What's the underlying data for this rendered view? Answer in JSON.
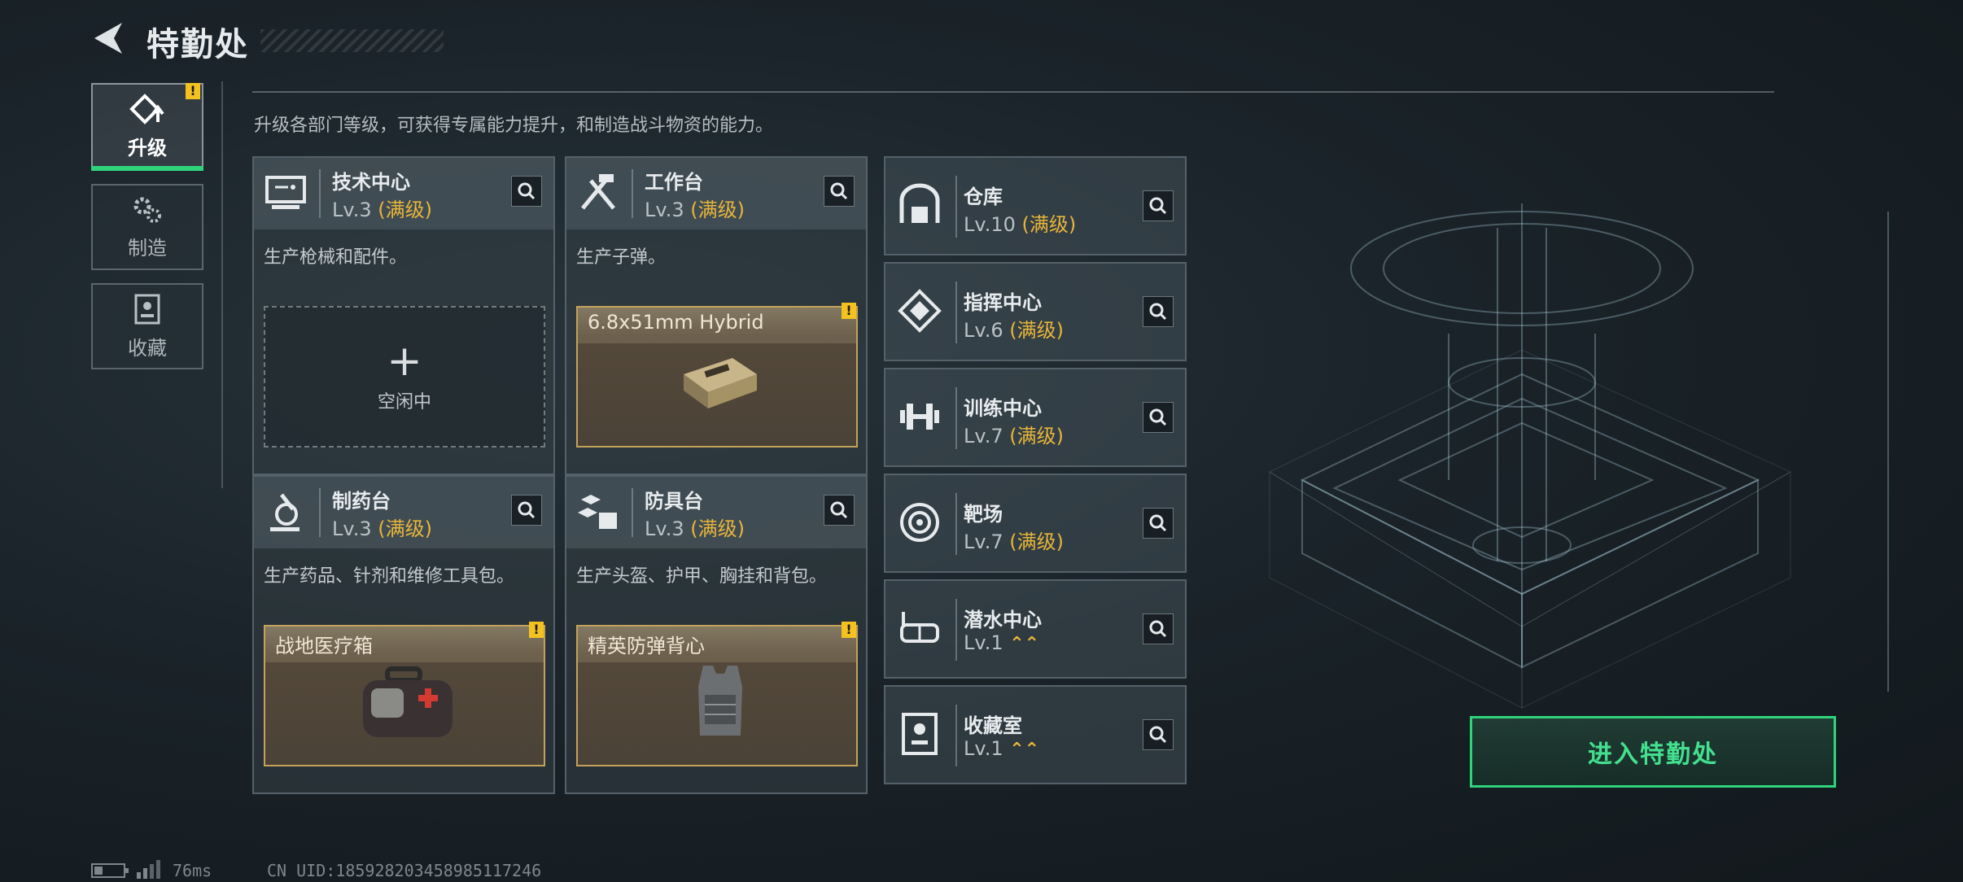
{
  "header": {
    "title": "特勤处"
  },
  "nav": {
    "items": [
      {
        "label": "升级",
        "active": true,
        "icon": "upgrade-icon"
      },
      {
        "label": "制造",
        "active": false,
        "icon": "gears-icon"
      },
      {
        "label": "收藏",
        "active": false,
        "icon": "collection-icon"
      }
    ],
    "warn_mark": "!"
  },
  "description": "升级各部门等级，可获得专属能力提升，和制造战斗物资的能力。",
  "cards": [
    {
      "name": "技术中心",
      "level": "Lv.3",
      "status": "(满级)",
      "desc": "生产枪械和配件。",
      "slot_type": "empty",
      "slot_text": "空闲中",
      "slot_plus": "+",
      "icon": "tech-center-icon"
    },
    {
      "name": "工作台",
      "level": "Lv.3",
      "status": "(满级)",
      "desc": "生产子弹。",
      "slot_type": "item",
      "slot_text": "6.8x51mm Hybrid",
      "icon": "workbench-icon"
    },
    {
      "name": "制药台",
      "level": "Lv.3",
      "status": "(满级)",
      "desc": "生产药品、针剂和维修工具包。",
      "slot_type": "item",
      "slot_text": "战地医疗箱",
      "icon": "pharmacy-icon"
    },
    {
      "name": "防具台",
      "level": "Lv.3",
      "status": "(满级)",
      "desc": "生产头盔、护甲、胸挂和背包。",
      "slot_type": "item",
      "slot_text": "精英防弹背心",
      "icon": "armor-bench-icon"
    }
  ],
  "list": [
    {
      "name": "仓库",
      "level": "Lv.10",
      "status": "(满级)",
      "icon": "warehouse-icon"
    },
    {
      "name": "指挥中心",
      "level": "Lv.6",
      "status": "(满级)",
      "icon": "command-center-icon"
    },
    {
      "name": "训练中心",
      "level": "Lv.7",
      "status": "(满级)",
      "icon": "training-icon"
    },
    {
      "name": "靶场",
      "level": "Lv.7",
      "status": "(满级)",
      "icon": "target-range-icon"
    },
    {
      "name": "潜水中心",
      "level": "Lv.1",
      "status": "",
      "upgradable": true,
      "icon": "dive-center-icon"
    },
    {
      "name": "收藏室",
      "level": "Lv.1",
      "status": "",
      "upgradable": true,
      "icon": "collection-room-icon"
    }
  ],
  "enter_button": "进入特勤处",
  "footer": {
    "ping": "76ms",
    "uid": "CN UID:185928203458985117246"
  },
  "colors": {
    "accent_green": "#2fd37b",
    "max_gold": "#e8b53a",
    "warn_yellow": "#f4c21f"
  }
}
